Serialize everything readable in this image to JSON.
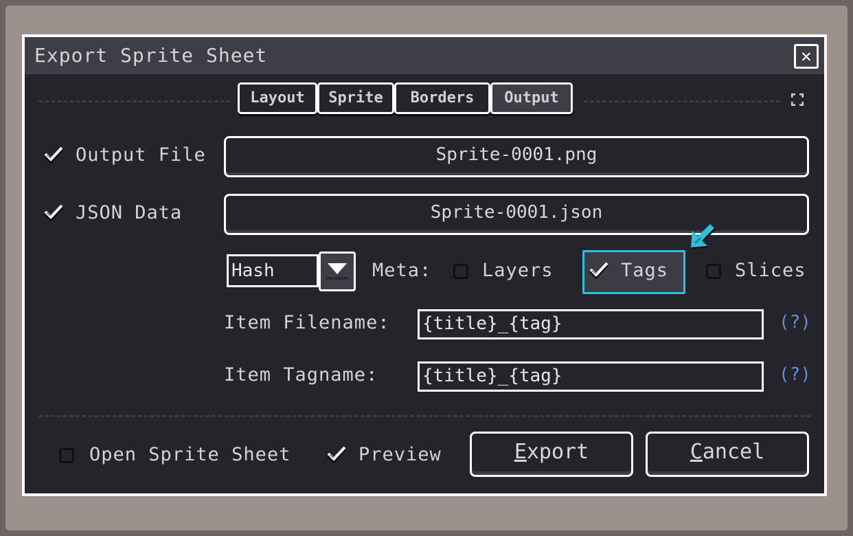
{
  "dialog": {
    "title": "Export Sprite Sheet",
    "close_glyph": "✕"
  },
  "tabs": [
    {
      "label": "Layout",
      "active": false
    },
    {
      "label": "Sprite",
      "active": false
    },
    {
      "label": "Borders",
      "active": false
    },
    {
      "label": "Output",
      "active": true
    }
  ],
  "output_file": {
    "label": "Output File",
    "checked": true,
    "value": "Sprite-0001.png"
  },
  "json_data": {
    "label": "JSON Data",
    "checked": true,
    "value": "Sprite-0001.json"
  },
  "json_format": {
    "selected": "Hash"
  },
  "meta": {
    "label": "Meta:",
    "layers": {
      "label": "Layers",
      "checked": false
    },
    "tags": {
      "label": "Tags",
      "checked": true
    },
    "slices": {
      "label": "Slices",
      "checked": false
    }
  },
  "item_filename": {
    "label": "Item Filename:",
    "value": "{title}_{tag}",
    "help": "(?)"
  },
  "item_tagname": {
    "label": "Item Tagname:",
    "value": "{title}_{tag}",
    "help": "(?)"
  },
  "footer": {
    "open_sprite_sheet": {
      "label": "Open Sprite Sheet",
      "checked": false
    },
    "preview": {
      "label": "Preview",
      "checked": true
    },
    "export": {
      "mnemonic": "E",
      "rest": "xport"
    },
    "cancel": {
      "mnemonic": "C",
      "rest": "ancel"
    }
  },
  "colors": {
    "accent": "#2ec0dc",
    "panel": "#24242a",
    "titlebar": "#3d3e46",
    "help_link": "#5f8fd6"
  },
  "icons": {
    "check": "check-icon",
    "dropdown": "chevron-down-icon",
    "expand": "expand-icon",
    "close": "close-icon",
    "pointer": "pointer-arrow-icon"
  }
}
